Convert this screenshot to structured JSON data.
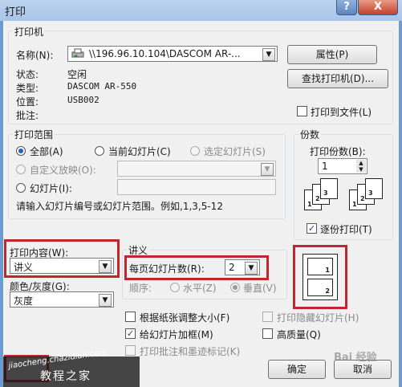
{
  "window": {
    "title": "打印",
    "help_label": "?",
    "close_label": "X"
  },
  "printer": {
    "group_label": "打印机",
    "name_label": "名称(N):",
    "name_value": "\\\\196.96.10.104\\DASCOM AR-...",
    "properties_button": "属性(P)",
    "find_button": "查找打印机(D)...",
    "status_label": "状态:",
    "status_value": "空闲",
    "type_label": "类型:",
    "type_value": "DASCOM AR-550",
    "where_label": "位置:",
    "where_value": "USB002",
    "comment_label": "批注:",
    "print_to_file_label": "打印到文件(L)",
    "print_to_file_checked": false
  },
  "range": {
    "group_label": "打印范围",
    "all_label": "全部(A)",
    "current_label": "当前幻灯片(C)",
    "selection_label": "选定幻灯片(S)",
    "custom_label": "自定义放映(O):",
    "slides_label": "幻灯片(I):",
    "hint": "请输入幻灯片编号或幻灯片范围。例如,1,3,5-12"
  },
  "copies": {
    "group_label": "份数",
    "count_label": "打印份数(B):",
    "count_value": "1",
    "collate_label": "逐份打印(T)",
    "collate_checked": true
  },
  "print_what": {
    "label": "打印内容(W):",
    "value": "讲义"
  },
  "color": {
    "label": "颜色/灰度(G):",
    "value": "灰度"
  },
  "handouts": {
    "group_label": "讲义",
    "per_page_label": "每页幻灯片数(R):",
    "per_page_value": "2",
    "order_label": "顺序:",
    "horizontal_label": "水平(Z)",
    "vertical_label": "垂直(V)",
    "preview_pages": [
      "1",
      "2"
    ]
  },
  "options": {
    "scale_label": "根据纸张调整大小(F)",
    "frame_label": "给幻灯片加框(M)",
    "comments_label": "打印批注和墨迹标记(K)",
    "hidden_label": "打印隐藏幻灯片(H)",
    "quality_label": "高质量(Q)"
  },
  "footer": {
    "ok_button": "确定",
    "cancel_button": "取消",
    "watermark_text": "jiaocheng.chazidian.com",
    "watermark_sub": "教程之家",
    "baidu_watermark": "Bai 经验"
  }
}
